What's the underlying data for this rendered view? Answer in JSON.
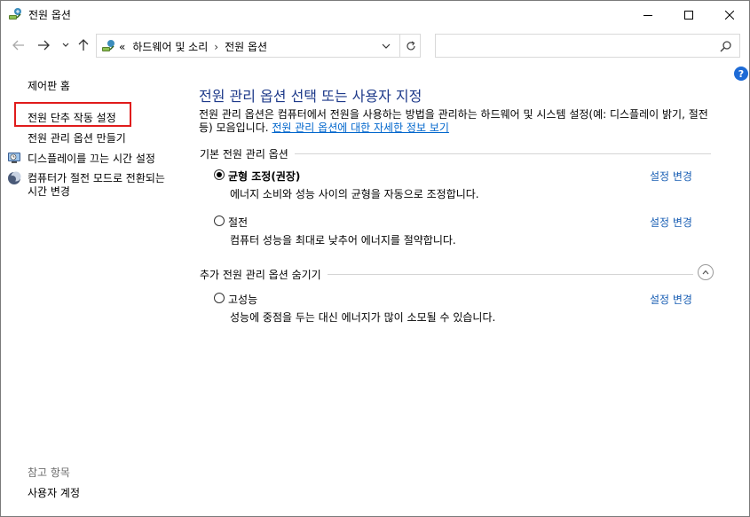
{
  "window": {
    "title": "전원 옵션",
    "colors": {
      "link": "#0066cc",
      "heading": "#1e3a8a",
      "highlight": "#e01b1b",
      "help": "#1e6bd6"
    }
  },
  "address": {
    "prefix": "«",
    "crumbs": [
      "하드웨어 및 소리",
      "전원 옵션"
    ],
    "separator": "›"
  },
  "search": {
    "placeholder": "",
    "value": ""
  },
  "help": {
    "label": "?"
  },
  "left": {
    "home": "제어판 홈",
    "power_button": "전원 단추 작동 설정",
    "create_plan": "전원 관리 옵션 만들기",
    "display_off": "디스플레이를 끄는 시간 설정",
    "sleep": "컴퓨터가 절전 모드로 전환되는 시간 변경",
    "see_also": "참고 항목",
    "user_accounts": "사용자 계정"
  },
  "main": {
    "title": "전원 관리 옵션 선택 또는 사용자 지정",
    "description": "전원 관리 옵션은 컴퓨터에서 전원을 사용하는 방법을 관리하는 하드웨어 및 시스템 설정(예: 디스플레이 밝기, 절전 등) 모음입니다. ",
    "more_info_link": "전원 관리 옵션에 대한 자세한 정보 보기",
    "basic_header": "기본 전원 관리 옵션",
    "extra_header": "추가 전원 관리 옵션 숨기기",
    "plans": [
      {
        "name": "균형 조정(권장)",
        "description": "에너지 소비와 성능 사이의 균형을 자동으로 조정합니다.",
        "selected": true,
        "change": "설정 변경"
      },
      {
        "name": "절전",
        "description": "컴퓨터 성능을 최대로 낮추어 에너지를 절약합니다.",
        "selected": false,
        "change": "설정 변경"
      },
      {
        "name": "고성능",
        "description": "성능에 중점을 두는 대신 에너지가 많이 소모될 수 있습니다.",
        "selected": false,
        "change": "설정 변경"
      }
    ]
  }
}
